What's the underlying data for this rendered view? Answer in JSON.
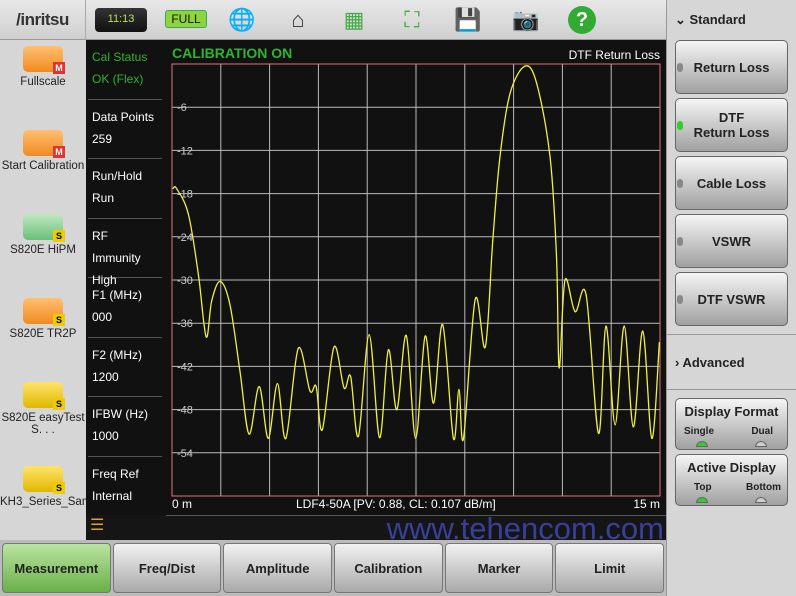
{
  "header": {
    "brand": "/inritsu",
    "clock": "11:13",
    "battery": "FULL"
  },
  "left_apps": [
    {
      "label": "Fullscale",
      "badge": "M"
    },
    {
      "label": "Start Calibration",
      "badge": "M"
    },
    {
      "label": "S820E HiPM",
      "badge": "S"
    },
    {
      "label": "S820E TR2P",
      "badge": "S"
    },
    {
      "label": "S820E easyTest S. . .",
      "badge": "S"
    },
    {
      "label": "KH3_Series_Sample",
      "badge": "S"
    }
  ],
  "info": [
    {
      "label": "Cal Status",
      "value": "OK (Flex)"
    },
    {
      "label": "Data Points",
      "value": "259"
    },
    {
      "label": "Run/Hold",
      "value": "Run"
    },
    {
      "label": "RF Immunity",
      "value": "High"
    },
    {
      "label": "F1 (MHz)",
      "value": "000"
    },
    {
      "label": "F2 (MHz)",
      "value": "1200"
    },
    {
      "label": "IFBW (Hz)",
      "value": "1000"
    },
    {
      "label": "Freq Ref",
      "value": "Internal"
    }
  ],
  "plot": {
    "status": "CALIBRATION ON",
    "mode": "DTF Return Loss",
    "x_start": "0 m",
    "x_stop": "15 m",
    "cable": "LDF4-50A [PV: 0.88,  CL: 0.107 dB/m]"
  },
  "watermark": "www.tehencom.com",
  "tabs": [
    "Measurement",
    "Freq/Dist",
    "Amplitude",
    "Calibration",
    "Marker",
    "Limit"
  ],
  "right": {
    "standard": "Standard",
    "buttons": [
      {
        "label": "Return Loss",
        "active": false
      },
      {
        "label": "DTF\nReturn Loss",
        "active": true
      },
      {
        "label": "Cable Loss",
        "active": false
      },
      {
        "label": "VSWR",
        "active": false
      },
      {
        "label": "DTF VSWR",
        "active": false
      }
    ],
    "advanced": "Advanced",
    "display_format": {
      "title": "Display Format",
      "a": "Single",
      "b": "Dual",
      "selected": "Single"
    },
    "active_display": {
      "title": "Active Display",
      "a": "Top",
      "b": "Bottom",
      "selected": "Top"
    }
  },
  "chart_data": {
    "type": "line",
    "xlim": [
      0,
      15
    ],
    "ylim": [
      -60,
      0
    ],
    "x_unit": "m",
    "yticks": [
      -6,
      -12,
      -18,
      -24,
      -30,
      -36,
      -42,
      -48,
      -54
    ],
    "grid": true,
    "trace_color": "#f0f040",
    "points": [
      [
        0.03,
        -17.3
      ],
      [
        0.14,
        -17.3
      ],
      [
        0.5,
        -20.8
      ],
      [
        0.81,
        -29.2
      ],
      [
        1.05,
        -37.9
      ],
      [
        1.22,
        -32.9
      ],
      [
        1.48,
        -30.2
      ],
      [
        1.78,
        -33.4
      ],
      [
        2.09,
        -42.7
      ],
      [
        2.37,
        -51.4
      ],
      [
        2.68,
        -44.8
      ],
      [
        2.96,
        -52
      ],
      [
        3.24,
        -44.4
      ],
      [
        3.5,
        -52
      ],
      [
        3.88,
        -39.5
      ],
      [
        4.24,
        -45.4
      ],
      [
        4.43,
        -44.8
      ],
      [
        4.62,
        -50.8
      ],
      [
        4.98,
        -39.3
      ],
      [
        5.29,
        -45
      ],
      [
        5.49,
        -43.4
      ],
      [
        5.73,
        -51.7
      ],
      [
        6.06,
        -37.6
      ],
      [
        6.38,
        -51.9
      ],
      [
        6.65,
        -39.7
      ],
      [
        6.91,
        -48
      ],
      [
        7.2,
        -37.7
      ],
      [
        7.49,
        -52
      ],
      [
        7.78,
        -37.8
      ],
      [
        8.04,
        -47.1
      ],
      [
        8.32,
        -36.2
      ],
      [
        8.65,
        -52
      ],
      [
        8.82,
        -45.2
      ],
      [
        8.96,
        -52
      ],
      [
        9.32,
        -32.7
      ],
      [
        9.63,
        -39.3
      ],
      [
        9.86,
        -24.5
      ],
      [
        10.08,
        -12.9
      ],
      [
        10.39,
        -4.1
      ],
      [
        10.85,
        -0.3
      ],
      [
        11.21,
        -2.7
      ],
      [
        11.62,
        -12.9
      ],
      [
        11.82,
        -26.9
      ],
      [
        11.9,
        -42.2
      ],
      [
        12.08,
        -30
      ],
      [
        12.39,
        -34.4
      ],
      [
        12.73,
        -32.1
      ],
      [
        13.11,
        -51.3
      ],
      [
        13.34,
        -36.4
      ],
      [
        13.62,
        -50.1
      ],
      [
        13.9,
        -36.4
      ],
      [
        14.18,
        -50.4
      ],
      [
        14.47,
        -37.1
      ],
      [
        14.75,
        -52
      ],
      [
        14.98,
        -38.7
      ]
    ]
  }
}
